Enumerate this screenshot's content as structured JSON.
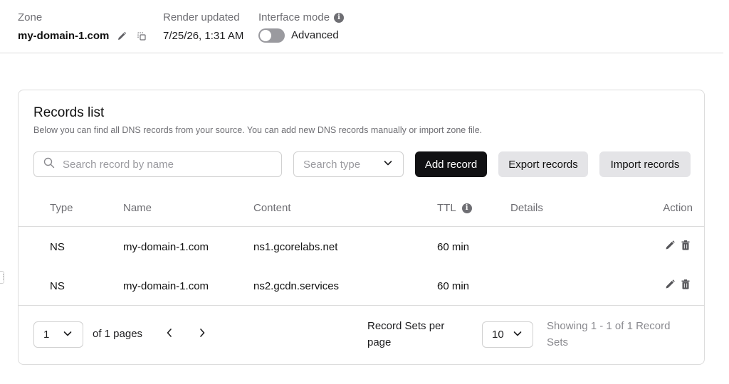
{
  "header": {
    "zone_label": "Zone",
    "zone_name": "my-domain-1.com",
    "render_label": "Render updated",
    "render_value": "7/25/26, 1:31 AM",
    "mode_label": "Interface mode",
    "mode_value": "Advanced",
    "mode_toggle_on": false
  },
  "records": {
    "title": "Records list",
    "subtitle": "Below you can find all DNS records from your source. You can add new DNS records manually or import zone file.",
    "search_placeholder": "Search record by name",
    "type_placeholder": "Search type",
    "add_label": "Add record",
    "export_label": "Export records",
    "import_label": "Import records",
    "columns": {
      "type": "Type",
      "name": "Name",
      "content": "Content",
      "ttl": "TTL",
      "details": "Details",
      "action": "Action"
    },
    "rows": [
      {
        "type": "NS",
        "name": "my-domain-1.com",
        "content": "ns1.gcorelabs.net",
        "ttl": "60 min",
        "details": ""
      },
      {
        "type": "NS",
        "name": "my-domain-1.com",
        "content": "ns2.gcdn.services",
        "ttl": "60 min",
        "details": ""
      }
    ]
  },
  "pagination": {
    "current_page": "1",
    "of_pages": "of 1 pages",
    "per_page_label": "Record Sets per page",
    "per_page_value": "10",
    "showing": "Showing 1 - 1 of 1 Record Sets"
  },
  "colors": {
    "primary_button": "#111113",
    "secondary_button": "#e4e4e7",
    "muted_text": "#6e6e73",
    "border": "#dcdcdc"
  },
  "icons": {
    "edit": "pencil-icon",
    "copy": "copy-icon",
    "info": "info-icon",
    "search": "search-icon",
    "chevron": "chevron-down-icon",
    "delete": "trash-icon",
    "prev": "chevron-left-icon",
    "next": "chevron-right-icon"
  }
}
